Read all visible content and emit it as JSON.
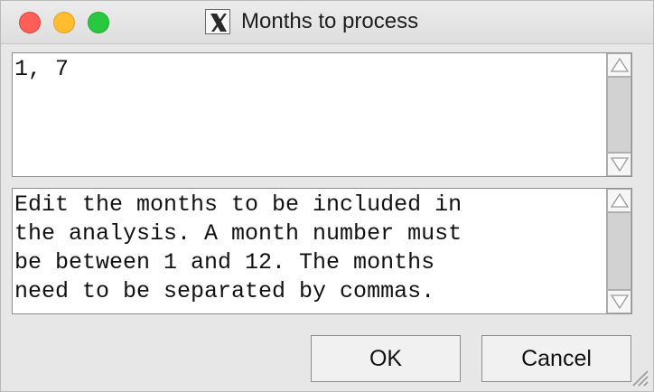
{
  "window": {
    "title": "Months to process"
  },
  "editor": {
    "value": "1, 7"
  },
  "help": {
    "text": "Edit the months to be included in\nthe analysis. A month number must\nbe between 1 and 12. The months\nneed to be separated by commas."
  },
  "buttons": {
    "ok": "OK",
    "cancel": "Cancel"
  },
  "icons": {
    "app": "x11-icon",
    "close": "close-icon",
    "minimize": "minimize-icon",
    "maximize": "maximize-icon"
  },
  "colors": {
    "close": "#ff5f57",
    "minimize": "#febc2e",
    "maximize": "#28c840"
  }
}
